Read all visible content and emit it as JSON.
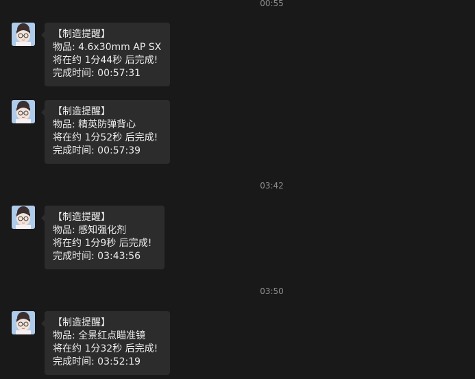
{
  "timestamps": [
    "00:55",
    "03:42",
    "03:50"
  ],
  "messages": [
    {
      "title": "【制造提醒】",
      "item": "物品: 4.6x30mm AP SX",
      "eta": "将在约 1分44秒 后完成!",
      "done": "完成时间: 00:57:31"
    },
    {
      "title": "【制造提醒】",
      "item": "物品: 精英防弹背心",
      "eta": "将在约 1分52秒 后完成!",
      "done": "完成时间: 00:57:39"
    },
    {
      "title": "【制造提醒】",
      "item": "物品: 感知强化剂",
      "eta": "将在约 1分9秒 后完成!",
      "done": "完成时间: 03:43:56"
    },
    {
      "title": "【制造提醒】",
      "item": "物品: 全景红点瞄准镜",
      "eta": "将在约 1分32秒 后完成!",
      "done": "完成时间: 03:52:19"
    }
  ],
  "colors": {
    "background": "#191919",
    "bubble": "#2c2c2c",
    "timestamp": "#8f8f8f"
  },
  "icons": {
    "avatar": "avatar-icon"
  }
}
